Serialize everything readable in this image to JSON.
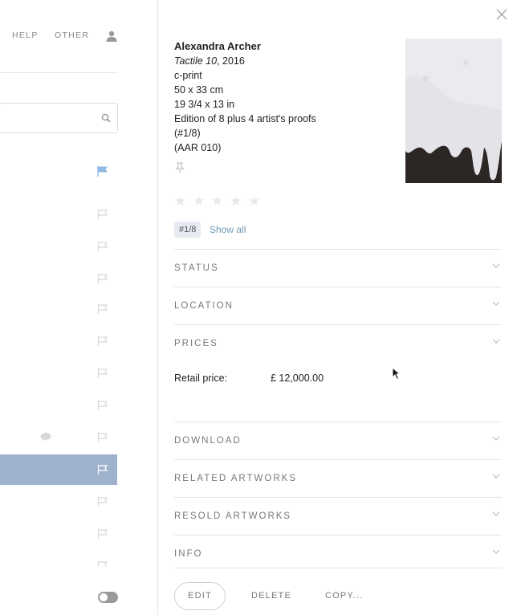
{
  "nav": {
    "help": "HELP",
    "other": "OTHER"
  },
  "artwork": {
    "artist": "Alexandra Archer",
    "title": "Tactile 10",
    "year": ", 2016",
    "medium": "c-print",
    "dimensions_cm": "50 x 33 cm",
    "dimensions_in": "19 3/4 x 13 in",
    "edition": "Edition of 8 plus 4 artist's proofs",
    "edition_number": "(#1/8)",
    "code": "(AAR 010)"
  },
  "rating": {
    "stars": 0,
    "max": 5
  },
  "edition_badge": "#1/8",
  "show_all": "Show all",
  "sections": {
    "status": "STATUS",
    "location": "LOCATION",
    "prices": "PRICES",
    "download": "DOWNLOAD",
    "related": "RELATED ARTWORKS",
    "resold": "RESOLD ARTWORKS",
    "info": "INFO"
  },
  "prices": {
    "retail_label": "Retail price:",
    "retail_value": "£ 12,000.00"
  },
  "actions": {
    "edit": "EDIT",
    "delete": "DELETE",
    "copy": "COPY..."
  },
  "colors": {
    "accent_flag": "#8fbbe3",
    "selected_row": "#9fb2cc",
    "link": "#6f9bb8"
  }
}
